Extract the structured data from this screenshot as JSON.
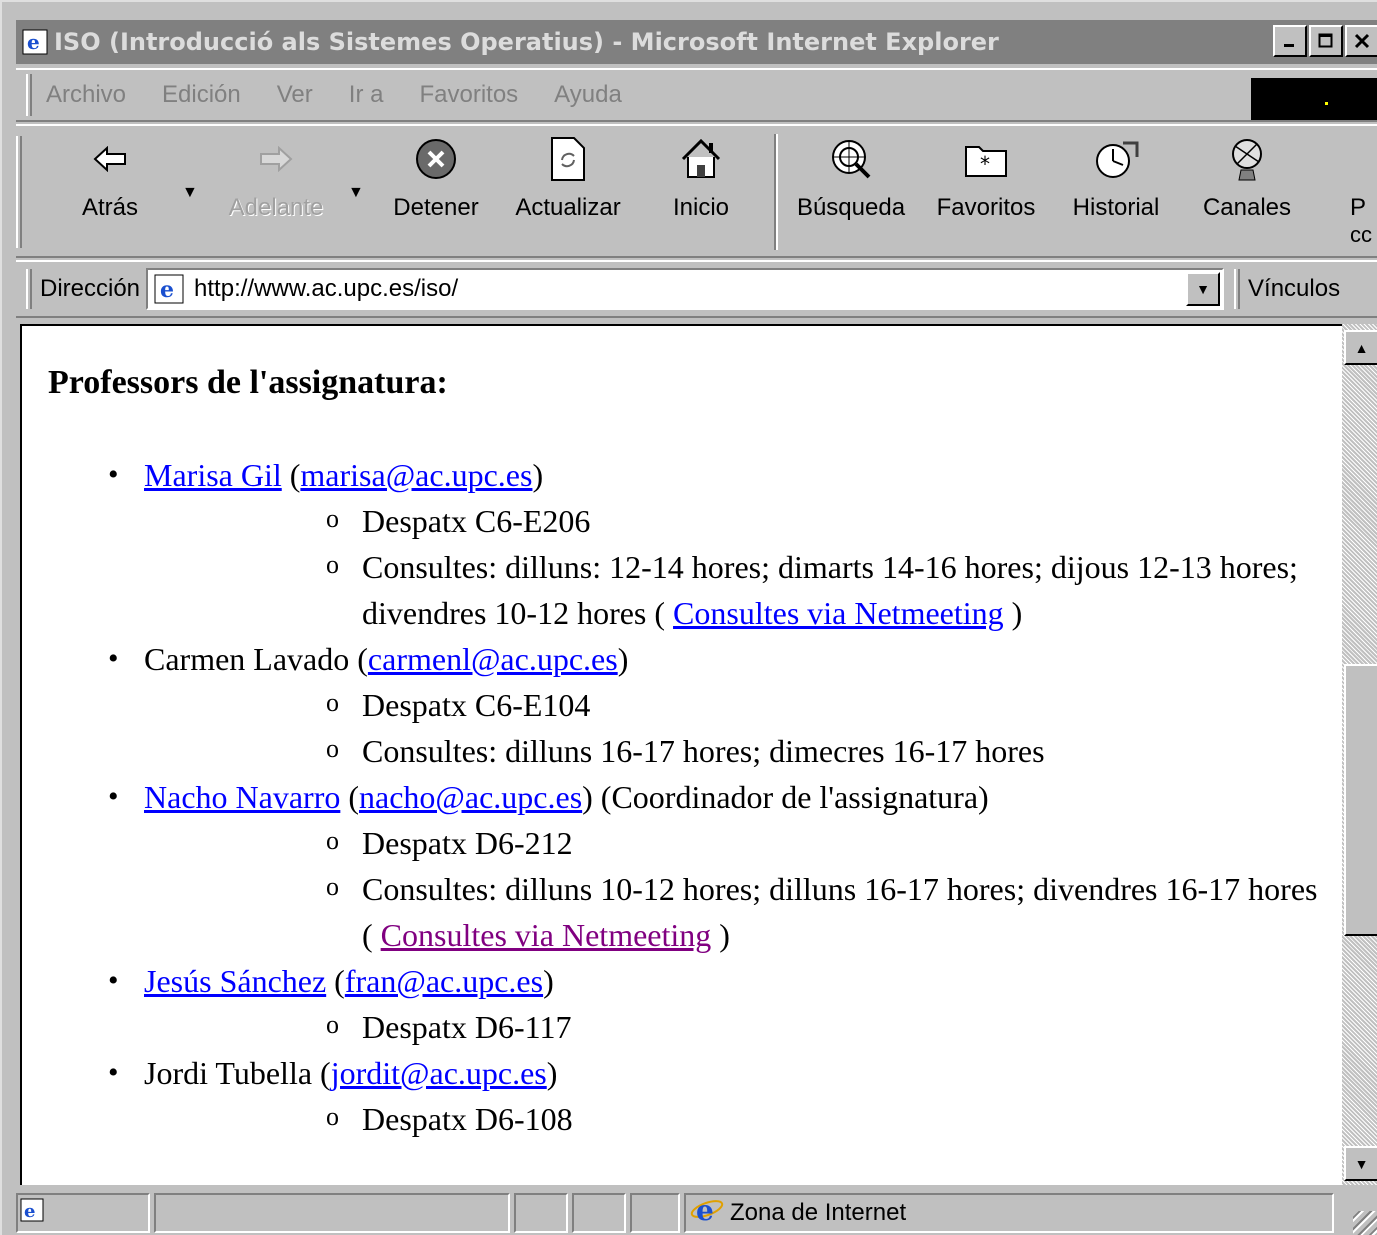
{
  "window": {
    "title": "ISO (Introducció als Sistemes Operatius) - Microsoft Internet Explorer",
    "title_icon": "ie-page-icon",
    "buttons": [
      "minimize-icon",
      "maximize-icon",
      "close-icon"
    ]
  },
  "menu": {
    "items": [
      {
        "label": "Archivo",
        "underline": "A"
      },
      {
        "label": "Edición",
        "underline": "E"
      },
      {
        "label": "Ver",
        "underline": "V"
      },
      {
        "label": "Ir a",
        "underline": "I"
      },
      {
        "label": "Favoritos",
        "underline": "F"
      },
      {
        "label": "Ayuda",
        "underline": "u"
      }
    ]
  },
  "toolbar": {
    "back": "Atrás",
    "forward": "Adelante",
    "stop": "Detener",
    "refresh": "Actualizar",
    "home": "Inicio",
    "search": "Búsqueda",
    "favorites": "Favoritos",
    "history": "Historial",
    "channels": "Canales",
    "fullscreen_partial": "P",
    "fullscreen_partial2": "cc"
  },
  "address": {
    "label": "Dirección",
    "url": "http://www.ac.upc.es/iso/",
    "links_label": "Vínculos"
  },
  "content": {
    "heading": "Professors de l'assignatura:",
    "professors": [
      {
        "name": "Marisa Gil",
        "name_link": true,
        "email": "marisa@ac.upc.es",
        "extra": "",
        "office": "Despatx C6-E206",
        "hours": "Consultes: dilluns: 12-14 hores; dimarts 14-16 hores; dijous 12-13 hores; divendres 10-12 hores (",
        "netmeeting": "Consultes via Netmeeting",
        "netmeeting_visited": false
      },
      {
        "name": "Carmen Lavado",
        "name_link": false,
        "email": "carmenl@ac.upc.es",
        "extra": "",
        "office": "Despatx C6-E104",
        "hours": "Consultes: dilluns 16-17 hores; dimecres 16-17 hores"
      },
      {
        "name": "Nacho Navarro",
        "name_link": true,
        "email": "nacho@ac.upc.es",
        "extra": " (Coordinador de l'assignatura)",
        "office": "Despatx D6-212",
        "hours": "Consultes: dilluns 10-12 hores; dilluns 16-17 hores; divendres 16-17 hores (",
        "netmeeting": "Consultes via Netmeeting",
        "netmeeting_visited": true
      },
      {
        "name": "Jesús Sánchez",
        "name_link": true,
        "email": "fran@ac.upc.es",
        "extra": "",
        "office": "Despatx D6-117"
      },
      {
        "name": "Jordi Tubella",
        "name_link": false,
        "email": "jordit@ac.upc.es",
        "extra": "",
        "office": "Despatx D6-108"
      }
    ]
  },
  "status": {
    "zone": "Zona de Internet"
  },
  "colors": {
    "link": "#0000ff",
    "visited": "#800080",
    "chrome": "#c0c0c0",
    "title_inactive": "#808080"
  }
}
